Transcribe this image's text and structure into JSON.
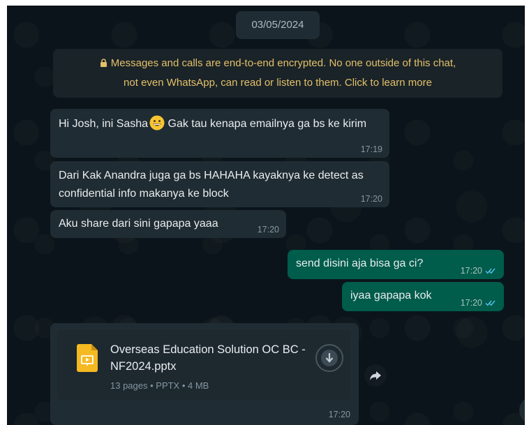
{
  "date_chip": "03/05/2024",
  "encryption_notice": {
    "line1": "Messages and calls are end-to-end encrypted. No one outside of this chat,",
    "line2": "not even WhatsApp, can read or listen to them. Click to learn more"
  },
  "messages": [
    {
      "direction": "incoming",
      "text_before_emoji": "Hi Josh, ini Sasha",
      "text_after_emoji": " Gak tau kenapa emailnya ga bs ke kirim",
      "time": "17:19"
    },
    {
      "direction": "incoming",
      "text": "Dari Kak Anandra juga ga bs HAHAHA kayaknya ke detect as confidential info makanya ke block",
      "time": "17:20"
    },
    {
      "direction": "incoming",
      "text": "Aku share dari sini gapapa yaaa",
      "time": "17:20"
    },
    {
      "direction": "outgoing",
      "text": "send disini aja bisa ga ci?",
      "time": "17:20",
      "status": "read"
    },
    {
      "direction": "outgoing",
      "text": "iyaa gapapa kok",
      "time": "17:20",
      "status": "read"
    }
  ],
  "file_message": {
    "name": "Overseas Education Solution OC BC - NF2024.pptx",
    "meta": "13 pages • PPTX • 4 MB",
    "time": "17:20",
    "icon": "pptx-file-icon"
  },
  "colors": {
    "chat_background": "#0b141a",
    "incoming_bubble": "#202c33",
    "outgoing_bubble": "#005c4b",
    "encryption_text": "#e3c06a",
    "read_tick": "#53bdeb"
  }
}
